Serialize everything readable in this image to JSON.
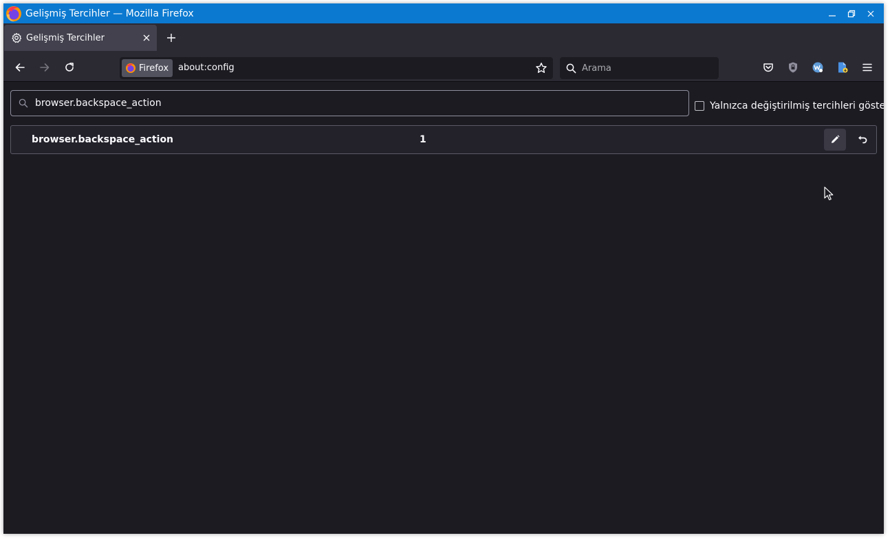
{
  "window": {
    "title": "Gelişmiş Tercihler — Mozilla Firefox"
  },
  "tabs": [
    {
      "title": "Gelişmiş Tercihler",
      "icon": "gear-icon",
      "active": true
    }
  ],
  "navbar": {
    "identity_label": "Firefox",
    "url": "about:config",
    "search_placeholder": "Arama"
  },
  "config": {
    "search_value": "browser.backspace_action",
    "show_modified_label": "Yalnızca değiştirilmiş tercihleri göster",
    "show_modified_checked": false,
    "prefs": [
      {
        "name": "browser.backspace_action",
        "value": "1"
      }
    ]
  },
  "colors": {
    "titlebar": "#0b79d0",
    "toolbar": "#2b2a33",
    "content_bg": "#1c1b22"
  }
}
